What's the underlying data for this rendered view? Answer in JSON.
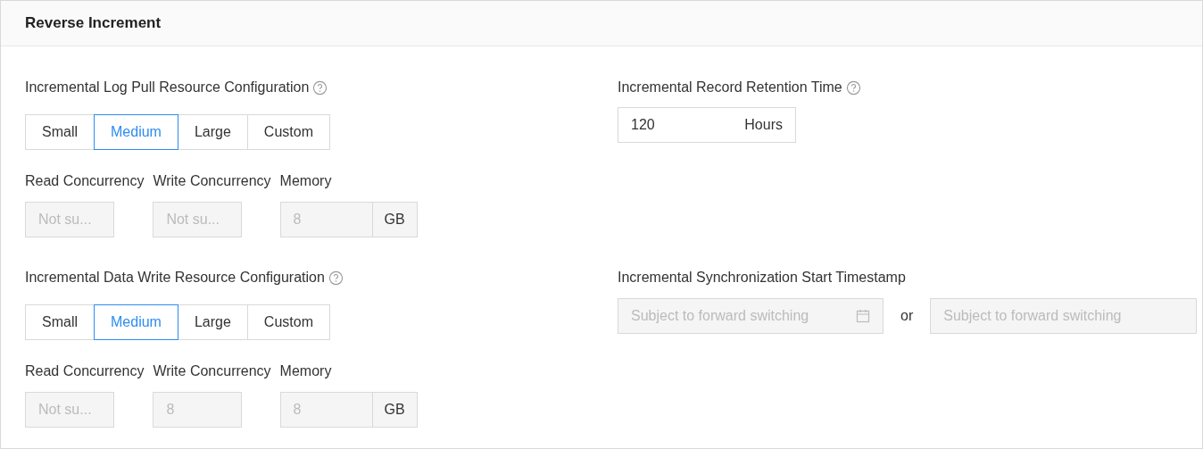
{
  "header": {
    "title": "Reverse Increment"
  },
  "sections": [
    {
      "label": "Incremental Log Pull Resource Configuration",
      "help": true,
      "options": [
        {
          "label": "Small",
          "selected": false
        },
        {
          "label": "Medium",
          "selected": true
        },
        {
          "label": "Large",
          "selected": false
        },
        {
          "label": "Custom",
          "selected": false
        }
      ],
      "fields": [
        {
          "label": "Read Concurrency",
          "value": "Not su...",
          "disabled": true
        },
        {
          "label": "Write Concurrency",
          "value": "Not su...",
          "disabled": true
        },
        {
          "label": "Memory",
          "value": "8",
          "suffix": "GB",
          "disabled": true
        }
      ]
    },
    {
      "label": "Incremental Data Write Resource Configuration",
      "help": true,
      "options": [
        {
          "label": "Small",
          "selected": false
        },
        {
          "label": "Medium",
          "selected": true
        },
        {
          "label": "Large",
          "selected": false
        },
        {
          "label": "Custom",
          "selected": false
        }
      ],
      "fields": [
        {
          "label": "Read Concurrency",
          "value": "Not su...",
          "disabled": true
        },
        {
          "label": "Write Concurrency",
          "value": "8",
          "disabled": true
        },
        {
          "label": "Memory",
          "value": "8",
          "suffix": "GB",
          "disabled": true
        }
      ]
    }
  ],
  "retention": {
    "label": "Incremental Record Retention Time",
    "help": true,
    "value": "120",
    "suffix": "Hours"
  },
  "start_timestamp": {
    "label": "Incremental Synchronization Start Timestamp",
    "help": false,
    "start": {
      "placeholder": "Subject to forward switching",
      "disabled": true
    },
    "separator": "or",
    "end": {
      "placeholder": "Subject to forward switching",
      "disabled": true
    }
  }
}
